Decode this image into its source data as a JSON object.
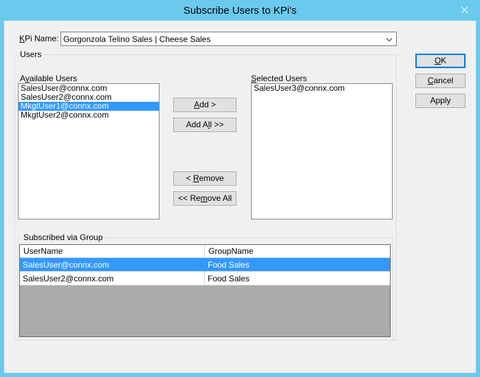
{
  "window": {
    "title": "Subscribe Users to KPi's"
  },
  "kpi": {
    "label_prefix": "K",
    "label_rest": "Pi Name:",
    "value": "Gorgonzola Telino Sales | Cheese Sales"
  },
  "users_group": {
    "title": "Users"
  },
  "available": {
    "label_prefix": "A",
    "label_u": "v",
    "label_rest": "ailable Users",
    "items": [
      {
        "label": "SalesUser@connx.com",
        "selected": false
      },
      {
        "label": "SalesUser2@connx.com",
        "selected": false
      },
      {
        "label": "MkgtUser1@connx.com",
        "selected": true
      },
      {
        "label": "MkgtUser2@connx.com",
        "selected": false
      }
    ]
  },
  "selected_users": {
    "label_u": "S",
    "label_rest": "elected Users",
    "items": [
      {
        "label": "SalesUser3@connx.com"
      }
    ]
  },
  "buttons": {
    "add": {
      "u": "A",
      "rest": "dd >"
    },
    "add_all_pre": "Add A",
    "add_all_u": "l",
    "add_all_post": "l >>",
    "remove_pre": "< ",
    "remove_u": "R",
    "remove_post": "emove",
    "remove_all_pre": "<< Re",
    "remove_all_u": "m",
    "remove_all_post": "ove All",
    "ok_u": "O",
    "ok_rest": "K",
    "cancel_u": "C",
    "cancel_rest": "ancel",
    "apply": "Apply"
  },
  "subscribed": {
    "title": "Subscribed via Group",
    "columns": [
      "UserName",
      "GroupName"
    ],
    "rows": [
      {
        "user": "SalesUser@connx.com",
        "group": "Food Sales",
        "selected": true
      },
      {
        "user": "SalesUser2@connx.com",
        "group": "Food Sales",
        "selected": false
      }
    ]
  },
  "colors": {
    "titlebar": "#6bc9ee",
    "selection": "#3399ff"
  }
}
